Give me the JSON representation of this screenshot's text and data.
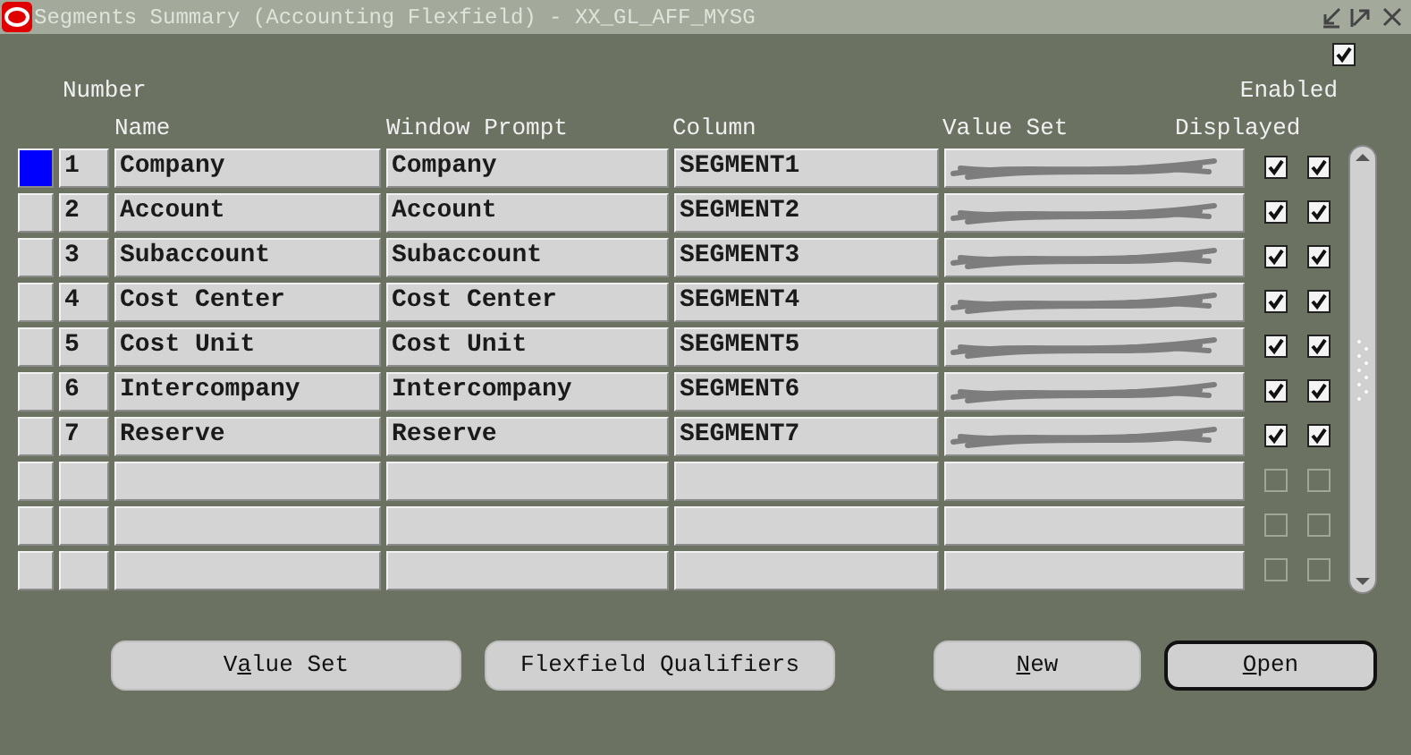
{
  "window": {
    "title": "Segments Summary (Accounting Flexfield) - XX_GL_AFF_MYSG"
  },
  "top_checkbox": {
    "checked": true
  },
  "headers": {
    "number": "Number",
    "name": "Name",
    "prompt": "Window Prompt",
    "column": "Column",
    "value_set": "Value Set",
    "displayed": "Displayed",
    "enabled": "Enabled"
  },
  "rows": [
    {
      "selected": true,
      "number": "1",
      "name": "Company",
      "prompt": "Company",
      "column": "SEGMENT1",
      "value_set": {
        "kind": "redacted"
      },
      "displayed": true,
      "enabled": true
    },
    {
      "selected": false,
      "number": "2",
      "name": "Account",
      "prompt": "Account",
      "column": "SEGMENT2",
      "value_set": {
        "kind": "redacted"
      },
      "displayed": true,
      "enabled": true
    },
    {
      "selected": false,
      "number": "3",
      "name": "Subaccount",
      "prompt": "Subaccount",
      "column": "SEGMENT3",
      "value_set": {
        "kind": "redacted"
      },
      "displayed": true,
      "enabled": true
    },
    {
      "selected": false,
      "number": "4",
      "name": "Cost Center",
      "prompt": "Cost Center",
      "column": "SEGMENT4",
      "value_set": {
        "kind": "redacted"
      },
      "displayed": true,
      "enabled": true
    },
    {
      "selected": false,
      "number": "5",
      "name": "Cost Unit",
      "prompt": "Cost Unit",
      "column": "SEGMENT5",
      "value_set": {
        "kind": "redacted"
      },
      "displayed": true,
      "enabled": true
    },
    {
      "selected": false,
      "number": "6",
      "name": "Intercompany",
      "prompt": "Intercompany",
      "column": "SEGMENT6",
      "value_set": {
        "kind": "redacted"
      },
      "displayed": true,
      "enabled": true
    },
    {
      "selected": false,
      "number": "7",
      "name": "Reserve",
      "prompt": "Reserve",
      "column": "SEGMENT7",
      "value_set": {
        "kind": "redacted"
      },
      "displayed": true,
      "enabled": true
    },
    {
      "selected": false,
      "displayed": false,
      "enabled": false
    },
    {
      "selected": false,
      "displayed": false,
      "enabled": false
    },
    {
      "selected": false,
      "displayed": false,
      "enabled": false
    }
  ],
  "buttons": [
    {
      "pre": "V",
      "key": "a",
      "post": "lue Set",
      "focused": false
    },
    {
      "pre": "Flexfield Qualifiers",
      "focused": false
    },
    {
      "key": "N",
      "post": "ew",
      "focused": false
    },
    {
      "key": "O",
      "post": "pen",
      "focused": true
    }
  ]
}
